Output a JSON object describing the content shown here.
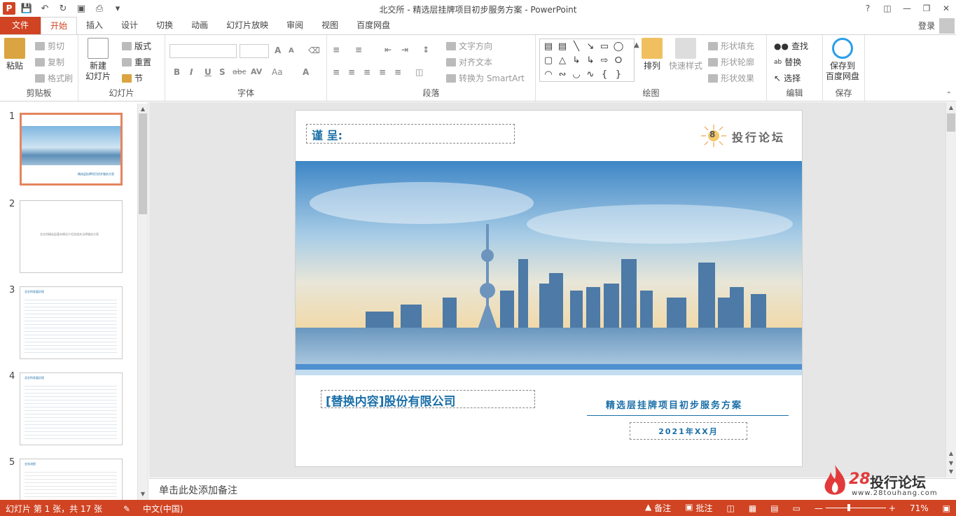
{
  "window": {
    "title": "北交所 - 精选层挂牌项目初步服务方案 - PowerPoint",
    "help": "?",
    "login": "登录"
  },
  "tabs": [
    "文件",
    "开始",
    "插入",
    "设计",
    "切换",
    "动画",
    "幻灯片放映",
    "审阅",
    "视图",
    "百度网盘"
  ],
  "ribbon": {
    "clipboard": {
      "label": "剪贴板",
      "paste": "粘贴",
      "cut": "剪切",
      "copy": "复制",
      "painter": "格式刷"
    },
    "slides": {
      "label": "幻灯片",
      "new_slide_1": "新建",
      "new_slide_2": "幻灯片",
      "layout": "版式",
      "reset": "重置",
      "section": "节"
    },
    "font": {
      "label": "字体",
      "bold": "B",
      "italic": "I",
      "underline": "U",
      "shadow": "S",
      "strike": "abc",
      "spacing": "AV",
      "case": "Aa",
      "color": "A",
      "grow": "A",
      "shrink": "A"
    },
    "paragraph": {
      "label": "段落",
      "text_direction": "文字方向",
      "align_text": "对齐文本",
      "smartart": "转换为 SmartArt"
    },
    "drawing": {
      "label": "绘图",
      "arrange": "排列",
      "quick_styles": "快速样式",
      "fill": "形状填充",
      "outline": "形状轮廓",
      "effects": "形状效果"
    },
    "editing": {
      "label": "编辑",
      "find": "查找",
      "replace": "替换",
      "select": "选择"
    },
    "save": {
      "label": "保存",
      "btn_1": "保存到",
      "btn_2": "百度网盘"
    }
  },
  "thumbnails": [
    {
      "num": "1",
      "caption": "精选层挂牌项目初步服务方案"
    },
    {
      "num": "2",
      "caption": "北交所精选层基本情况介绍及相关法律服务方案"
    },
    {
      "num": "3",
      "caption": "北交所发展历程"
    },
    {
      "num": "4",
      "caption": "北交所发展历程"
    },
    {
      "num": "5",
      "caption": "业务流程"
    }
  ],
  "slide": {
    "to_label": "谨 呈:",
    "logo_text": "投行论坛",
    "logo_badge": "8",
    "company": "[替换内容]股份有限公司",
    "plan_title": "精选层挂牌项目初步服务方案",
    "date": "2021年XX月"
  },
  "notes_placeholder": "单击此处添加备注",
  "status": {
    "slide_info": "幻灯片 第 1 张，共 17 张",
    "language": "中文(中国)",
    "notes": "备注",
    "comments": "批注",
    "zoom": "71%"
  },
  "watermark": {
    "number": "28",
    "brand": "投行论坛",
    "url": "www.28touhang.com"
  },
  "colors": {
    "accent": "#d04423",
    "slide_blue": "#1a6fa8",
    "thumb_selected": "#e4855f"
  }
}
